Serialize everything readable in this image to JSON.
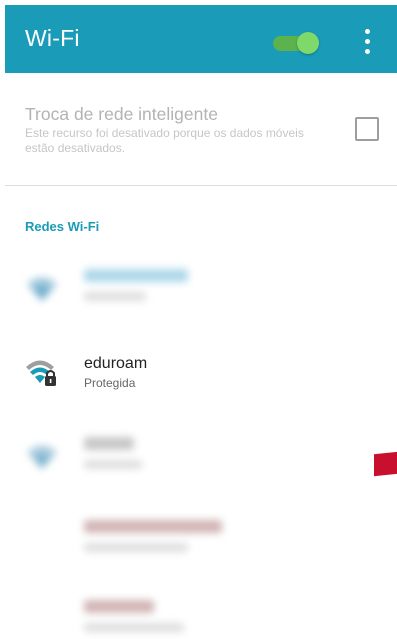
{
  "header": {
    "title": "Wi-Fi",
    "wifi_toggle_on": true
  },
  "smart_network_switch": {
    "title": "Troca de rede inteligente",
    "description": "Este recurso foi desativado porque os dados móveis estão desativados.",
    "checked": false
  },
  "section": {
    "label": "Redes Wi-Fi"
  },
  "networks": [
    {
      "name": "",
      "status": "",
      "blurred": true
    },
    {
      "name": "eduroam",
      "status": "Protegida",
      "blurred": false,
      "icon": "wifi-lock-icon"
    },
    {
      "name": "",
      "status": "",
      "blurred": true
    },
    {
      "name": "",
      "status": "",
      "blurred": true
    },
    {
      "name": "",
      "status": "",
      "blurred": true
    }
  ],
  "colors": {
    "header_bg": "#1a9bb8",
    "accent": "#1a9bb8",
    "toggle_track": "#5cb24d",
    "toggle_thumb": "#7fd86a",
    "marker": "#c8102e"
  }
}
